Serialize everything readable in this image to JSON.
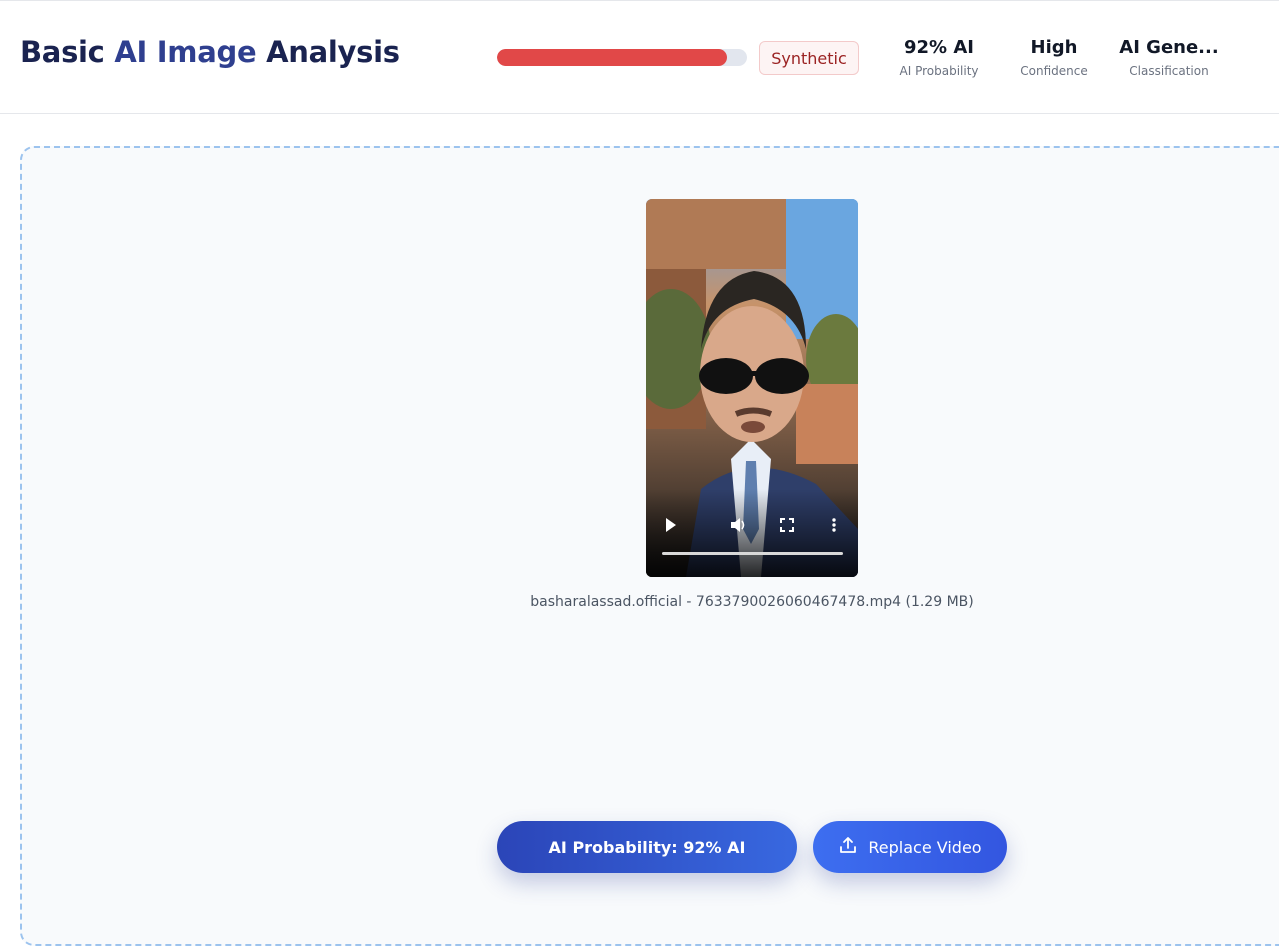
{
  "header": {
    "title_prefix": "Basic ",
    "title_accent": "AI Image",
    "title_suffix": " Analysis",
    "progress_fraction": 0.92,
    "badge": "Synthetic",
    "stats": [
      {
        "value": "92% AI",
        "label": "AI Probability"
      },
      {
        "value": "High",
        "label": "Confidence"
      },
      {
        "value": "AI Gene...",
        "label": "Classification"
      }
    ]
  },
  "video": {
    "controls": {
      "play": "play-icon",
      "volume": "volume-icon",
      "fullscreen": "fullscreen-icon",
      "more": "more-options-icon"
    },
    "caption": "basharalassad.official - 7633790026060467478.mp4 (1.29 MB)"
  },
  "actions": {
    "probability_button": "AI Probability: 92% AI",
    "replace_button": "Replace Video"
  },
  "colors": {
    "title": "#1a2350",
    "progress": "#e14848",
    "badge_text": "#9b2323",
    "primary": "#3356e0"
  }
}
